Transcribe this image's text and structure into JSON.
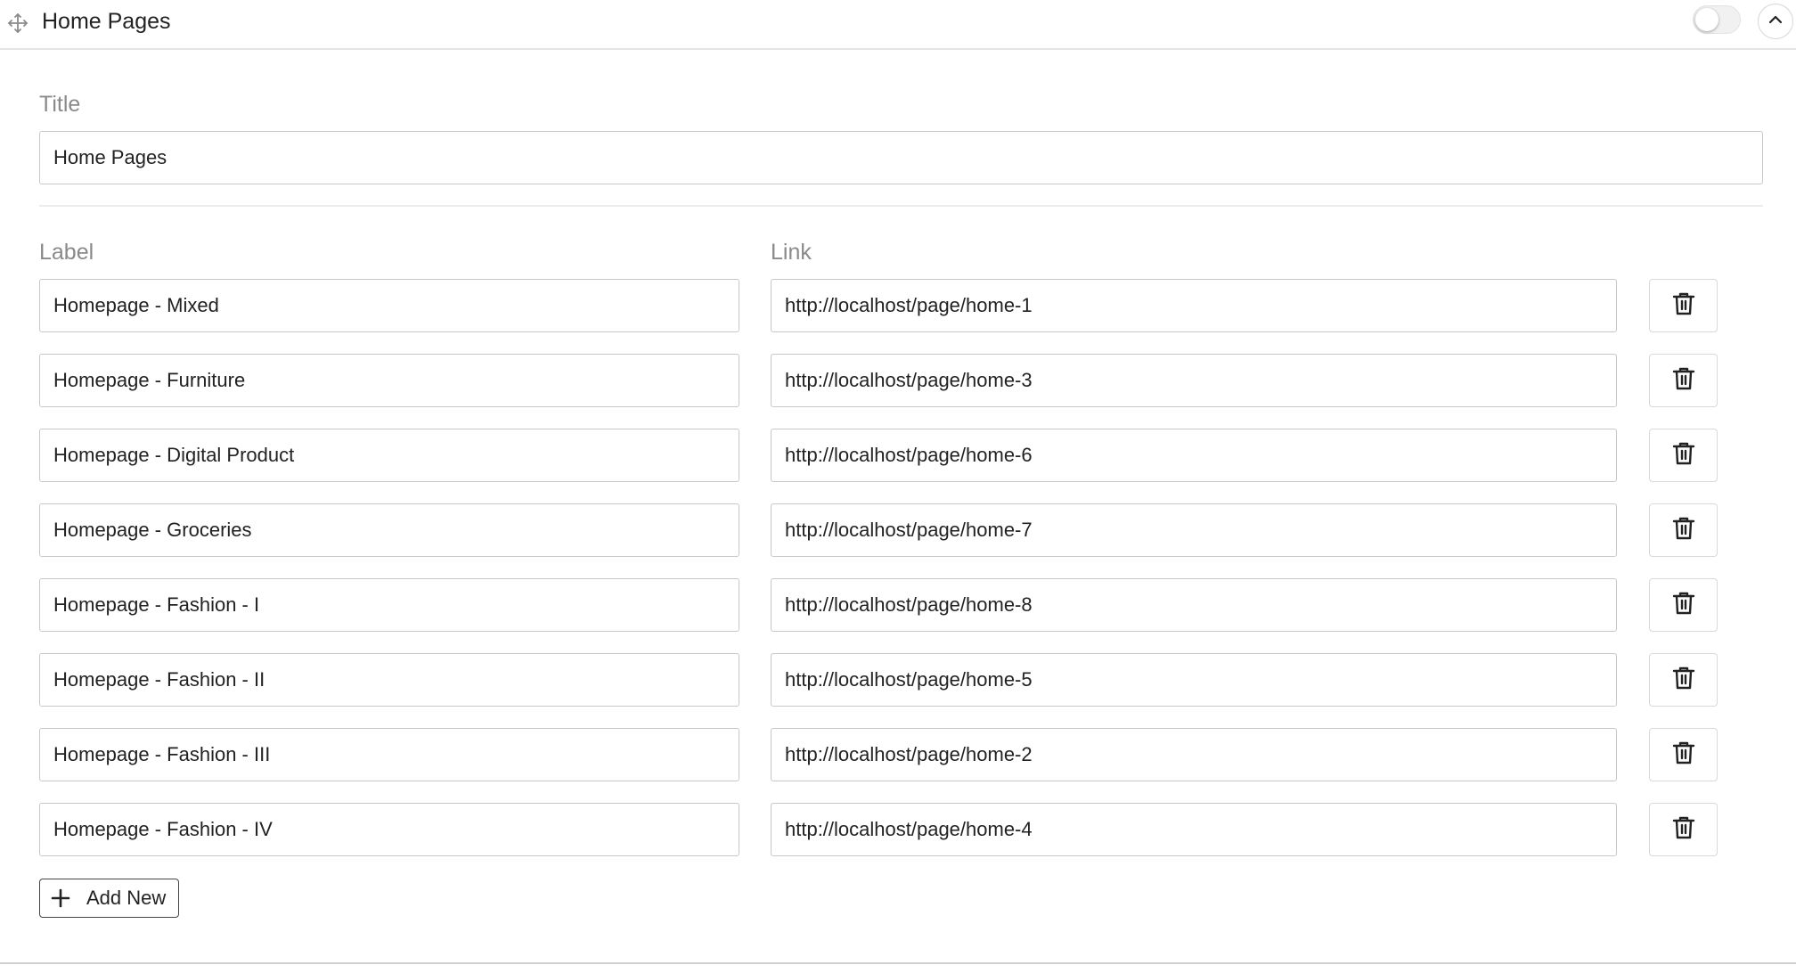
{
  "header": {
    "title": "Home Pages",
    "drag_icon": "move-arrows-icon",
    "toggle_state": "off",
    "collapse_icon": "chevron-up-icon"
  },
  "title_field": {
    "label": "Title",
    "value": "Home Pages"
  },
  "columns": {
    "label": "Label",
    "link": "Link"
  },
  "items": [
    {
      "label": "Homepage - Mixed",
      "link": "http://localhost/page/home-1"
    },
    {
      "label": "Homepage - Furniture",
      "link": "http://localhost/page/home-3"
    },
    {
      "label": "Homepage - Digital Product",
      "link": "http://localhost/page/home-6"
    },
    {
      "label": "Homepage - Groceries",
      "link": "http://localhost/page/home-7"
    },
    {
      "label": "Homepage - Fashion - I",
      "link": "http://localhost/page/home-8"
    },
    {
      "label": "Homepage - Fashion - II",
      "link": "http://localhost/page/home-5"
    },
    {
      "label": "Homepage - Fashion - III",
      "link": "http://localhost/page/home-2"
    },
    {
      "label": "Homepage - Fashion - IV",
      "link": "http://localhost/page/home-4"
    }
  ],
  "add_button": {
    "label": "Add New",
    "icon": "plus-icon"
  },
  "delete_icon": "trash-icon"
}
